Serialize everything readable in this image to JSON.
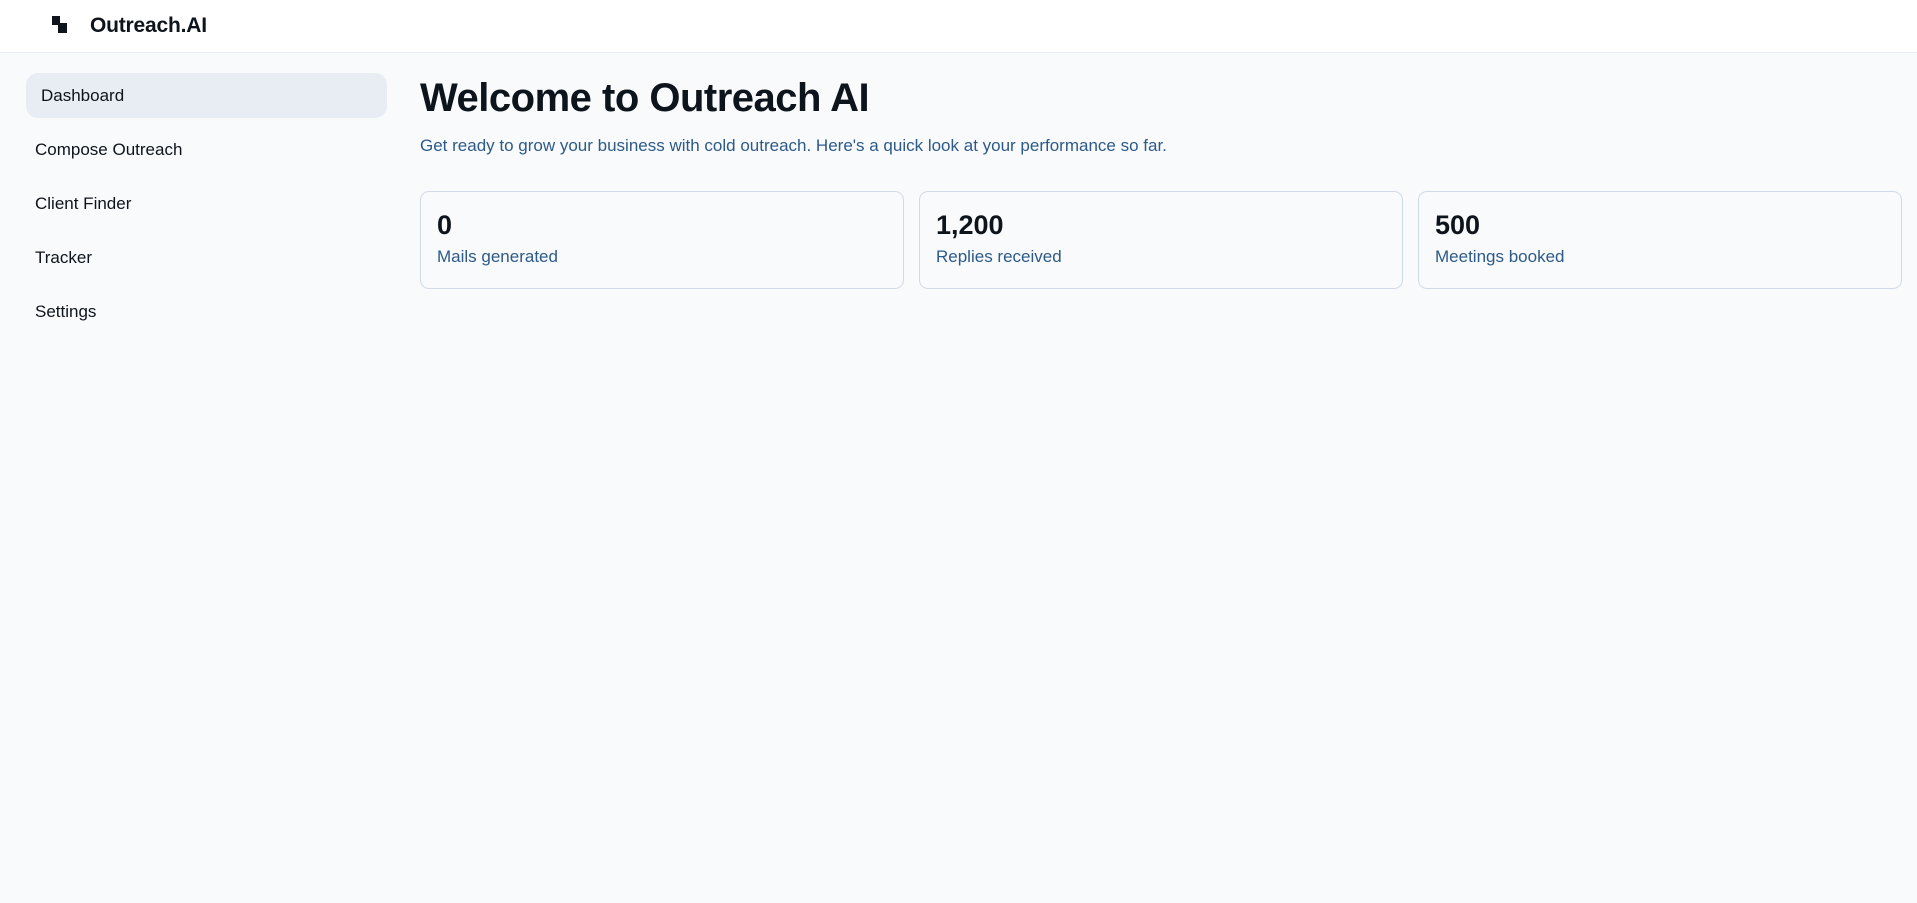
{
  "app": {
    "brand": "Outreach.AI",
    "logo_icon": "stacked-squares-icon"
  },
  "sidebar": {
    "items": [
      {
        "label": "Dashboard",
        "active": true
      },
      {
        "label": "Compose Outreach",
        "active": false
      },
      {
        "label": "Client Finder",
        "active": false
      },
      {
        "label": "Tracker",
        "active": false
      },
      {
        "label": "Settings",
        "active": false
      }
    ]
  },
  "main": {
    "title": "Welcome to Outreach AI",
    "subtitle": "Get ready to grow your business with cold outreach. Here's a quick look at your performance so far.",
    "stats": [
      {
        "value": "0",
        "label": "Mails generated"
      },
      {
        "value": "1,200",
        "label": "Replies received"
      },
      {
        "value": "500",
        "label": "Meetings booked"
      }
    ]
  },
  "colors": {
    "background": "#f8fafc",
    "header_bg": "#ffffff",
    "active_nav_bg": "#e7edf3",
    "text_primary": "#0e141b",
    "text_secondary": "#2d5a87",
    "card_border": "#d0dbe7"
  }
}
